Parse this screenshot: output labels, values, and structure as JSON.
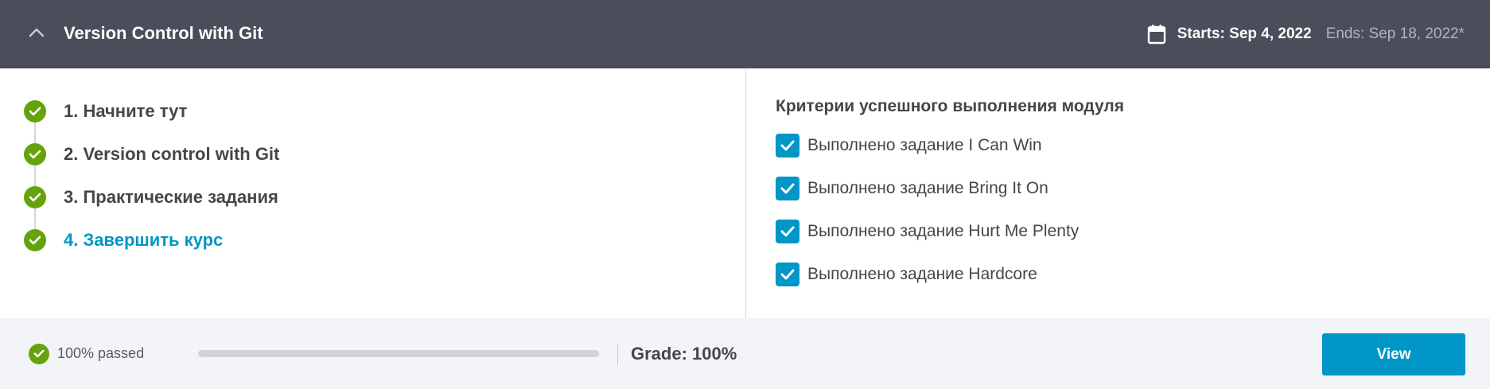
{
  "header": {
    "title": "Version Control with Git",
    "starts": "Starts: Sep 4, 2022",
    "ends": "Ends: Sep 18, 2022*",
    "calendar_icon": "calendar-icon",
    "collapse_icon": "chevron-up-icon"
  },
  "steps": [
    {
      "label": "1. Начните тут",
      "status": "completed",
      "active": false
    },
    {
      "label": "2. Version control with Git",
      "status": "completed",
      "active": false
    },
    {
      "label": "3. Практические задания",
      "status": "completed",
      "active": false
    },
    {
      "label": "4. Завершить курс",
      "status": "completed",
      "active": true
    }
  ],
  "criteria": {
    "title": "Критерии успешного выполнения модуля",
    "items": [
      {
        "label": "Выполнено задание I Can Win",
        "checked": true
      },
      {
        "label": "Выполнено задание Bring It On",
        "checked": true
      },
      {
        "label": "Выполнено задание Hurt Me Plenty",
        "checked": true
      },
      {
        "label": "Выполнено задание Hardcore",
        "checked": true
      }
    ]
  },
  "footer": {
    "passed": "100% passed",
    "progress_percent": 100,
    "grade": "Grade: 100%",
    "view_label": "View"
  },
  "colors": {
    "header_bg": "#4a4d5a",
    "accent": "#0096c7",
    "success": "#65a30d",
    "footer_bg": "#f3f4f7"
  }
}
